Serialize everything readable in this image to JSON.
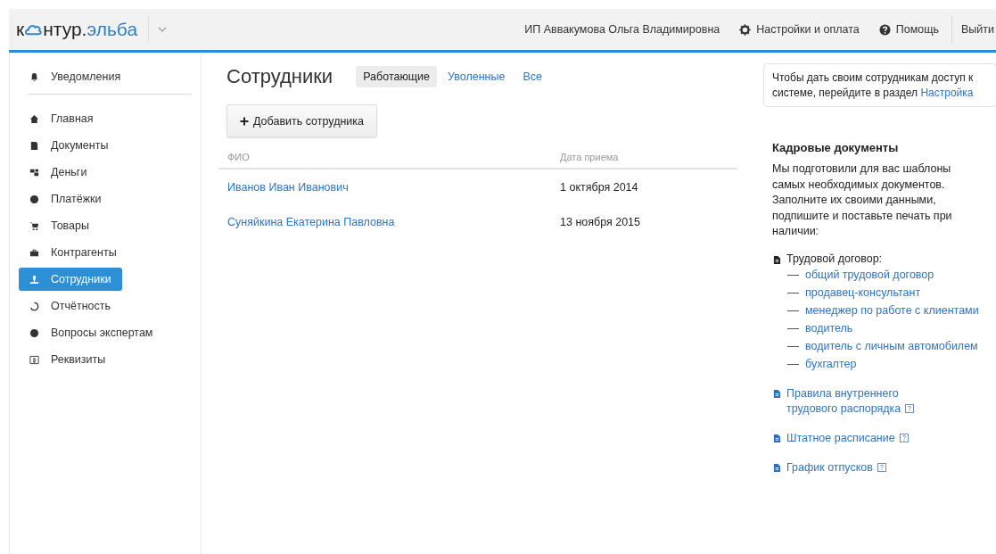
{
  "header": {
    "logo": {
      "part_1": "к",
      "part_2": "нтур.",
      "part_3": "эльба"
    },
    "user": "ИП Аввакумова Ольга Владимировна",
    "settings": "Настройки и оплата",
    "help": "Помощь",
    "logout": "Выйти"
  },
  "sidebar": {
    "items": [
      {
        "label": "Уведомления",
        "selected": false
      },
      {
        "label": "Главная",
        "selected": false
      },
      {
        "label": "Документы",
        "selected": false
      },
      {
        "label": "Деньги",
        "selected": false
      },
      {
        "label": "Платёжки",
        "selected": false
      },
      {
        "label": "Товары",
        "selected": false
      },
      {
        "label": "Контрагенты",
        "selected": false
      },
      {
        "label": "Сотрудники",
        "selected": true
      },
      {
        "label": "Отчётность",
        "selected": false
      },
      {
        "label": "Вопросы экспертам",
        "selected": false
      },
      {
        "label": "Реквизиты",
        "selected": false
      }
    ]
  },
  "main": {
    "title": "Сотрудники",
    "tabs": [
      {
        "label": "Работающие",
        "selected": true
      },
      {
        "label": "Уволенные",
        "selected": false
      },
      {
        "label": "Все",
        "selected": false
      }
    ],
    "add_button": "Добавить сотрудника",
    "table": {
      "columns": [
        "ФИО",
        "Дата приема"
      ],
      "rows": [
        [
          "Иванов Иван Иванович",
          "1 октября 2014"
        ],
        [
          "Суняйкина Екатерина Павловна",
          "13 ноября 2015"
        ]
      ]
    }
  },
  "aside": {
    "notice": {
      "text": "Чтобы дать своим сотрудникам доступ к системе, перейдите в раздел ",
      "link": "Настройка"
    },
    "title": "Кадровые документы",
    "intro": "Мы подготовили для вас шаблоны самых необходимых документов. Заполните их своими данными, подпишите и поставьте печать при наличии:",
    "contract": {
      "label": "Трудовой договор:",
      "links": [
        "общий трудовой договор",
        "продавец-консультант",
        "менеджер по работе с клиентами",
        "водитель",
        "водитель с личным автомобилем",
        "бухгалтер"
      ]
    },
    "documents": [
      {
        "label": "Правила внутреннего трудового распорядка"
      },
      {
        "label": "Штатное расписание"
      },
      {
        "label": "График отпусков"
      }
    ]
  }
}
